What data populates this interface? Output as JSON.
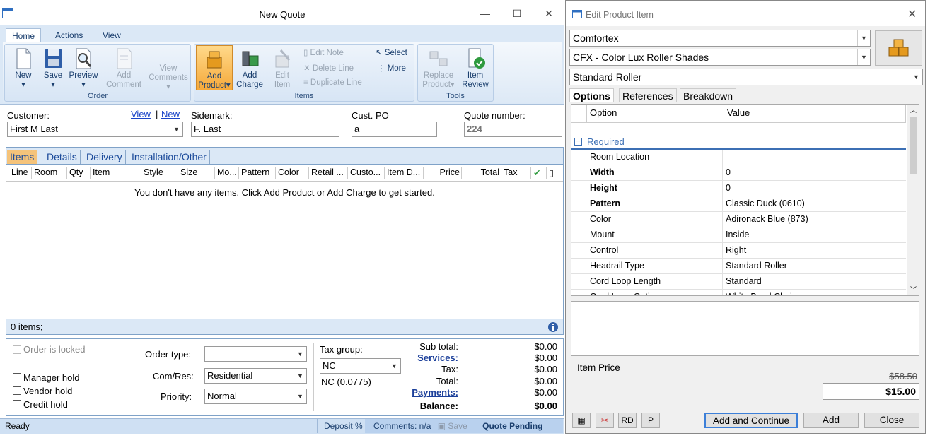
{
  "main": {
    "title": "New Quote",
    "ribbon": {
      "tabs": [
        "Home",
        "Actions",
        "View"
      ],
      "buttons": {
        "new": "New",
        "save": "Save",
        "preview": "Preview",
        "add_comment_1": "Add",
        "add_comment_2": "Comment",
        "view_comments_1": "View",
        "view_comments_2": "Comments",
        "add_product_1": "Add",
        "add_product_2": "Product",
        "add_charge_1": "Add",
        "add_charge_2": "Charge",
        "edit_item_1": "Edit",
        "edit_item_2": "Item",
        "edit_note": "Edit Note",
        "delete_line": "Delete Line",
        "duplicate_line": "Duplicate Line",
        "select": "Select",
        "more": "More",
        "replace_product_1": "Replace",
        "replace_product_2": "Product",
        "item_review_1": "Item",
        "item_review_2": "Review"
      },
      "groups": {
        "order": "Order",
        "items": "Items",
        "tools": "Tools"
      }
    },
    "customer": {
      "label": "Customer:",
      "view_link": "View",
      "separator": "|",
      "new_link": "New",
      "value": "First M Last",
      "sidemark_label": "Sidemark:",
      "sidemark_value": "F. Last",
      "cust_po_label": "Cust. PO",
      "cust_po_value": "a",
      "quote_number_label": "Quote number:",
      "quote_number_value": "224"
    },
    "item_tabs": [
      "Items",
      "Details",
      "Delivery",
      "Installation/Other"
    ],
    "columns": [
      "Line",
      "Room",
      "Qty",
      "Item",
      "Style",
      "Size",
      "Mo...",
      "Pattern",
      "Color",
      "Retail ...",
      "Custo...",
      "Item D...",
      "Price",
      "Total",
      "Tax"
    ],
    "empty_message": "You don't have any items. Click Add Product or Add Charge to get started.",
    "items_count": "0 items;",
    "bottom": {
      "order_locked": "Order is locked",
      "manager_hold": "Manager hold",
      "vendor_hold": "Vendor hold",
      "credit_hold": "Credit hold",
      "order_type_label": "Order type:",
      "order_type_value": "",
      "com_res_label": "Com/Res:",
      "com_res_value": "Residential",
      "priority_label": "Priority:",
      "priority_value": "Normal",
      "tax_group_label": "Tax group:",
      "tax_group_value": "NC",
      "tax_rate": "NC (0.0775)",
      "totals": {
        "subtotal_label": "Sub total:",
        "subtotal": "$0.00",
        "services_label": "Services:",
        "services": "$0.00",
        "tax_label": "Tax:",
        "tax": "$0.00",
        "total_label": "Total:",
        "total": "$0.00",
        "payments_label": "Payments:",
        "payments": "$0.00",
        "balance_label": "Balance:",
        "balance": "$0.00"
      }
    },
    "status": {
      "ready": "Ready",
      "deposit": "Deposit %",
      "comments": "Comments: n/a",
      "save": "Save",
      "quote_status": "Quote Pending"
    }
  },
  "dialog": {
    "title": "Edit Product Item",
    "manufacturer": "Comfortex",
    "product": "CFX - Color Lux Roller Shades",
    "style": "Standard Roller",
    "tabs": [
      "Options",
      "References",
      "Breakdown"
    ],
    "grid_headers": {
      "option": "Option",
      "value": "Value"
    },
    "group": "Required",
    "options": [
      {
        "name": "Room Location",
        "value": "",
        "bold": false
      },
      {
        "name": "Width",
        "value": "0",
        "bold": true
      },
      {
        "name": "Height",
        "value": "0",
        "bold": true
      },
      {
        "name": "Pattern",
        "value": "Classic Duck (0610)",
        "bold": true
      },
      {
        "name": "Color",
        "value": "Adironack Blue (873)",
        "bold": false
      },
      {
        "name": "Mount",
        "value": "Inside",
        "bold": false
      },
      {
        "name": "Control",
        "value": "Right",
        "bold": false
      },
      {
        "name": "Headrail Type",
        "value": "Standard Roller",
        "bold": false
      },
      {
        "name": "Cord Loop Length",
        "value": "Standard",
        "bold": false
      },
      {
        "name": "Cord Loop Option",
        "value": "White Bead Chain",
        "bold": false
      }
    ],
    "item_price_label": "Item Price",
    "list_price": "$58.50",
    "price": "$15.00",
    "buttons": {
      "rd": "RD",
      "p": "P",
      "add_continue": "Add and Continue",
      "add": "Add",
      "close": "Close"
    }
  }
}
